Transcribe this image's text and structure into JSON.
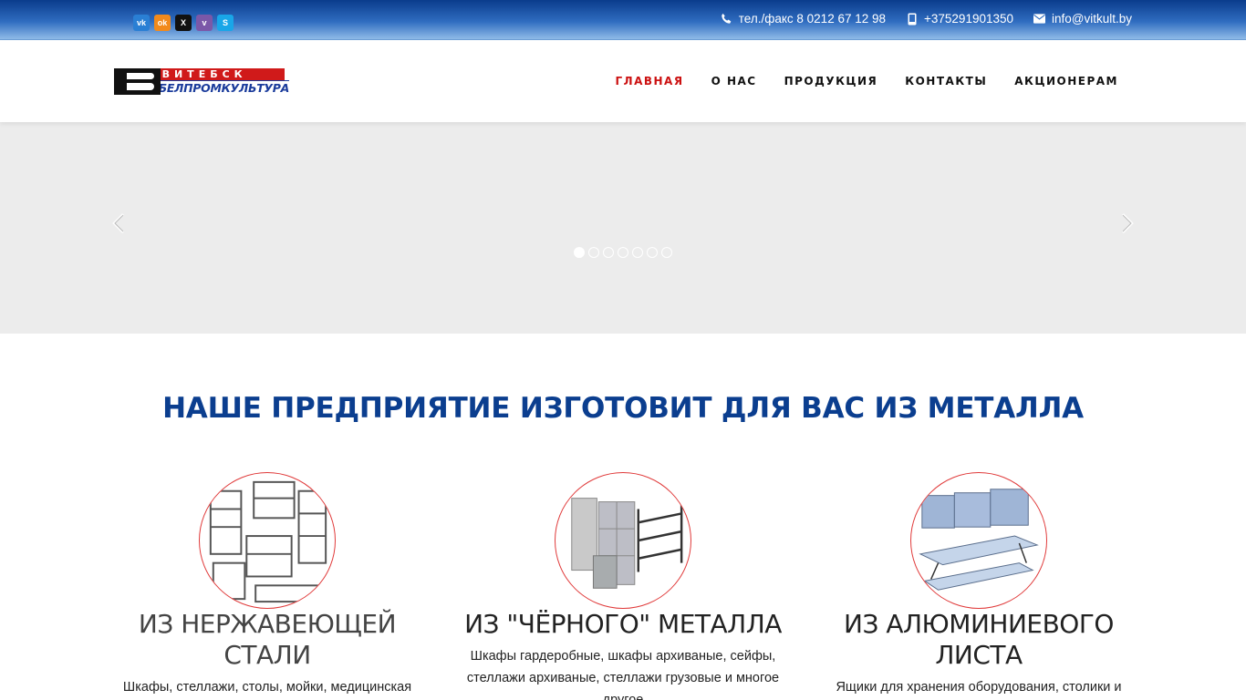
{
  "topbar": {
    "social": [
      {
        "name": "vk",
        "glyph": "vk"
      },
      {
        "name": "odnoklassniki",
        "glyph": "ok"
      },
      {
        "name": "x",
        "glyph": "X"
      },
      {
        "name": "viber",
        "glyph": "v"
      },
      {
        "name": "skype",
        "glyph": "S"
      }
    ],
    "phone_fax": "тел./факс 8 0212 67 12 98",
    "mobile": "+375291901350",
    "email": "info@vitkult.by"
  },
  "header": {
    "logo_top": "ВИТЕБСК",
    "logo_bottom": "БЕЛПРОМКУЛЬТУРА",
    "nav": [
      "ГЛАВНАЯ",
      "О НАС",
      "ПРОДУКЦИЯ",
      "КОНТАКТЫ",
      "АКЦИОНЕРАМ"
    ],
    "active_nav": "ГЛАВНАЯ"
  },
  "slider": {
    "dot_count": 7,
    "active_dot": 1
  },
  "main": {
    "headline": "НАШЕ ПРЕДПРИЯТИЕ ИЗГОТОВИТ ДЛЯ ВАС ИЗ МЕТАЛЛА",
    "columns": [
      {
        "title": "ИЗ НЕРЖАВЕЮЩЕЙ СТАЛИ",
        "text": "Шкафы, стеллажи, столы, мойки, медицинская"
      },
      {
        "title": "ИЗ \"ЧЁРНОГО\" МЕТАЛЛА",
        "text": "Шкафы гардеробные, шкафы архиваные, сейфы, стеллажи архиваные, стеллажи грузовые и многое другое"
      },
      {
        "title": "ИЗ АЛЮМИНИЕВОГО ЛИСТА",
        "text": "Ящики для хранения оборудования, столики и"
      }
    ]
  },
  "colors": {
    "accent_red": "#cc1111",
    "headline_blue": "#0b3e8f",
    "circle_border": "#e03a3a"
  }
}
